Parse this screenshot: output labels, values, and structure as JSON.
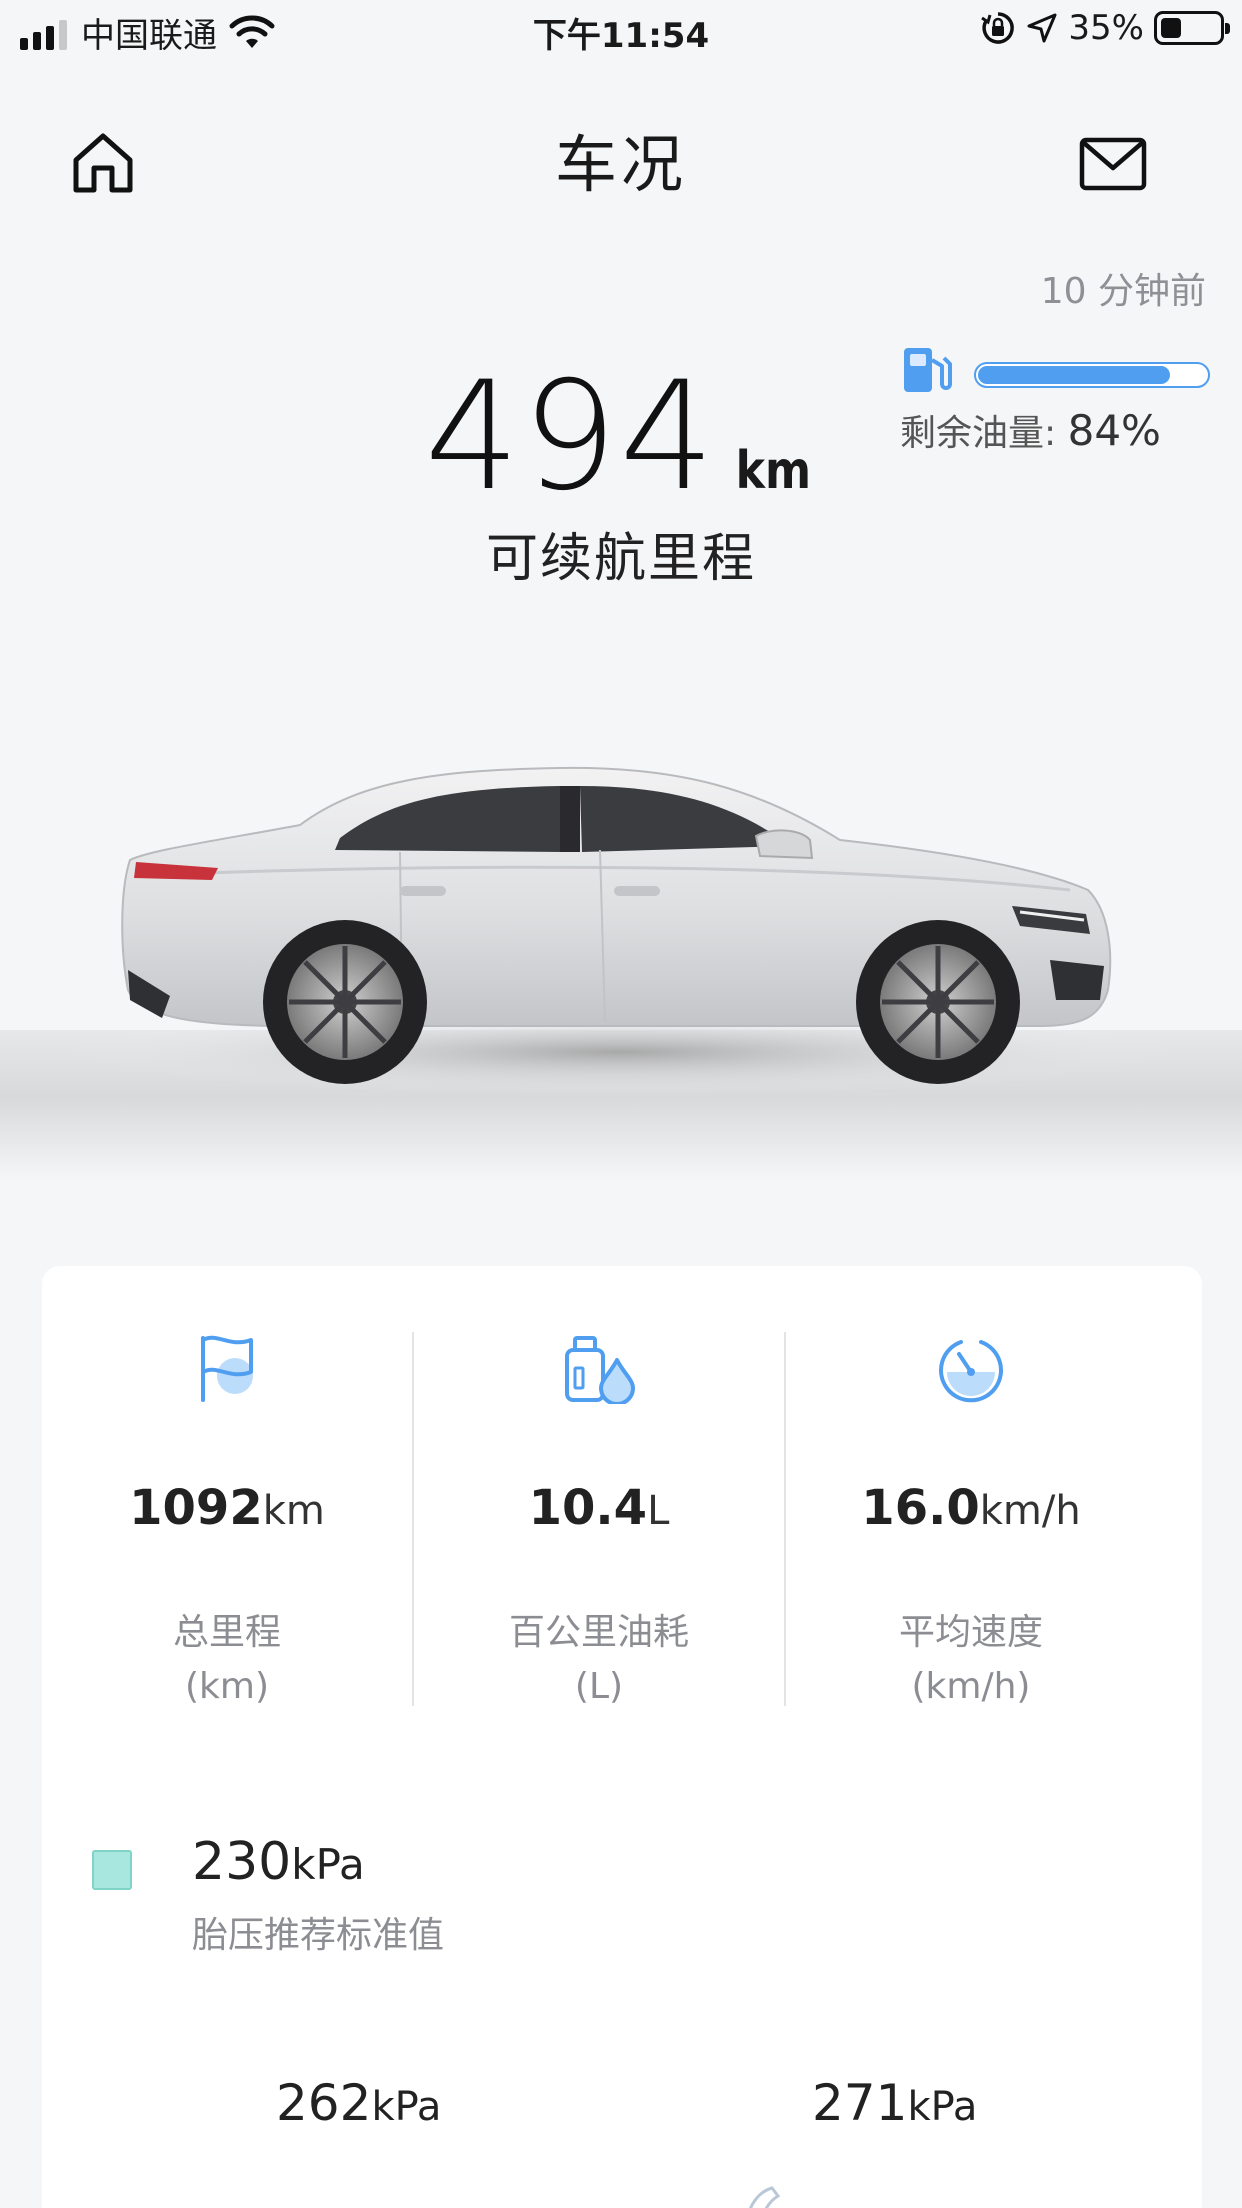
{
  "status_bar": {
    "carrier": "中国联通",
    "time": "下午11:54",
    "battery_pct": "35%",
    "battery_level": 0.35
  },
  "header": {
    "title": "车况",
    "home_icon": "home-icon",
    "mail_icon": "mail-icon"
  },
  "updated_text": "10 分钟前",
  "range": {
    "value": "494",
    "unit": "km",
    "label": "可续航里程"
  },
  "fuel": {
    "icon": "fuel-pump-icon",
    "level": 0.84,
    "label": "剩余油量:",
    "pct": "84%",
    "accent": "#4f9ef0"
  },
  "stats": [
    {
      "icon": "flag-icon",
      "value": "1092",
      "unit": "km",
      "label": "总里程",
      "sub": "(km)"
    },
    {
      "icon": "fuel-bottle-icon",
      "value": "10.4",
      "unit": "L",
      "label": "百公里油耗",
      "sub": "(L)"
    },
    {
      "icon": "speedometer-icon",
      "value": "16.0",
      "unit": "km/h",
      "label": "平均速度",
      "sub": "(km/h)"
    }
  ],
  "tire": {
    "legend_value": "230",
    "legend_unit": "kPa",
    "legend_label": "胎压推荐标准值",
    "legend_color": "#a8e7df",
    "front_left": "262",
    "front_right": "271",
    "unit": "kPa"
  }
}
